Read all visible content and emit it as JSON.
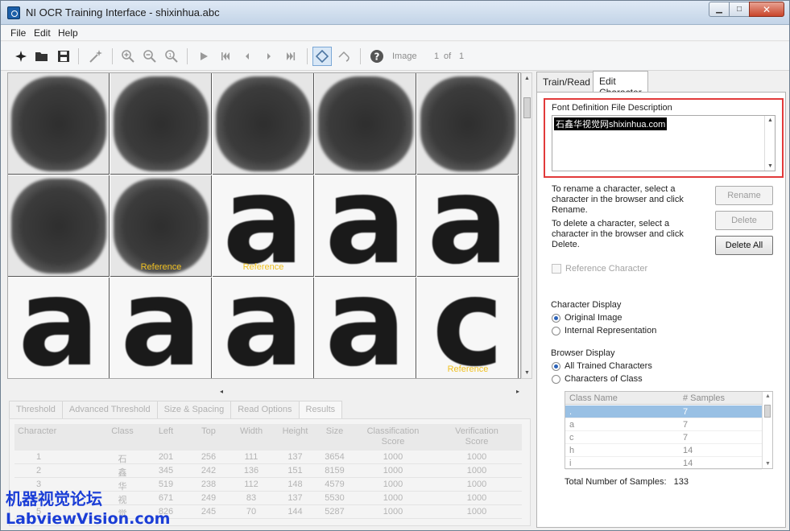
{
  "window": {
    "title": "NI OCR Training Interface - shixinhua.abc",
    "controls": {
      "minimize": "▁",
      "maximize": "□",
      "close": "✕"
    }
  },
  "menu": [
    "File",
    "Edit",
    "Help"
  ],
  "toolbar": {
    "image_label": "Image",
    "page_current": "1",
    "page_of": "of",
    "page_total": "1"
  },
  "grid": {
    "cells": [
      {
        "type": "blob",
        "ref": ""
      },
      {
        "type": "blob",
        "ref": ""
      },
      {
        "type": "blob",
        "ref": ""
      },
      {
        "type": "blob",
        "ref": ""
      },
      {
        "type": "blob",
        "ref": ""
      },
      {
        "type": "blob",
        "ref": ""
      },
      {
        "type": "blob",
        "ref": "Reference"
      },
      {
        "type": "glyph",
        "char": "a",
        "ref": "Reference"
      },
      {
        "type": "glyph",
        "char": "a",
        "ref": ""
      },
      {
        "type": "glyph",
        "char": "a",
        "ref": ""
      },
      {
        "type": "glyph",
        "char": "a",
        "ref": ""
      },
      {
        "type": "glyph",
        "char": "a",
        "ref": ""
      },
      {
        "type": "glyph",
        "char": "a",
        "ref": ""
      },
      {
        "type": "glyph",
        "char": "a",
        "ref": ""
      },
      {
        "type": "glyph",
        "char": "c",
        "ref": "Reference"
      }
    ]
  },
  "bottom_tabs": [
    "Threshold",
    "Advanced Threshold",
    "Size & Spacing",
    "Read Options",
    "Results"
  ],
  "results_table": {
    "columns": [
      "Character",
      "Class",
      "Left",
      "Top",
      "Width",
      "Height",
      "Size",
      "Classification\nScore",
      "Verification\nScore"
    ],
    "rows": [
      [
        "1",
        "石",
        "201",
        "256",
        "111",
        "137",
        "3654",
        "1000",
        "1000"
      ],
      [
        "2",
        "鑫",
        "345",
        "242",
        "136",
        "151",
        "8159",
        "1000",
        "1000"
      ],
      [
        "3",
        "华",
        "519",
        "238",
        "112",
        "148",
        "4579",
        "1000",
        "1000"
      ],
      [
        "4",
        "视",
        "671",
        "249",
        "83",
        "137",
        "5530",
        "1000",
        "1000"
      ],
      [
        "5",
        "觉",
        "826",
        "245",
        "70",
        "144",
        "5287",
        "1000",
        "1000"
      ]
    ]
  },
  "watermark": {
    "line1": "机器视觉论坛",
    "line2": "LabviewVision.com",
    "color": "#1a3dd6"
  },
  "right_tabs": [
    "Train/Read",
    "Edit Character Set File"
  ],
  "font_desc": {
    "label": "Font Definition File Description",
    "value": "石鑫华视觉网shixinhua.com"
  },
  "rename_info": "To rename a character, select a character in the browser and click Rename.",
  "delete_info": "To delete a character, select a character in the browser and click Delete.",
  "buttons": {
    "rename": "Rename",
    "delete": "Delete",
    "delete_all": "Delete All"
  },
  "reference_character": "Reference Character",
  "character_display": {
    "label": "Character Display",
    "options": [
      "Original Image",
      "Internal Representation"
    ],
    "selected": 0
  },
  "browser_display": {
    "label": "Browser Display",
    "options": [
      "All Trained Characters",
      "Characters of Class"
    ],
    "selected": 0
  },
  "class_table": {
    "columns": [
      "Class Name",
      "# Samples"
    ],
    "rows": [
      [
        ".",
        "7"
      ],
      [
        "a",
        "7"
      ],
      [
        "c",
        "7"
      ],
      [
        "h",
        "14"
      ],
      [
        "i",
        "14"
      ]
    ],
    "selected_row": 0
  },
  "total_samples": {
    "label": "Total Number of Samples:",
    "value": "133"
  },
  "colors": {
    "highlight_border": "#e23a3a",
    "reference_text": "#f0c020",
    "selection": "#99c0e4"
  }
}
